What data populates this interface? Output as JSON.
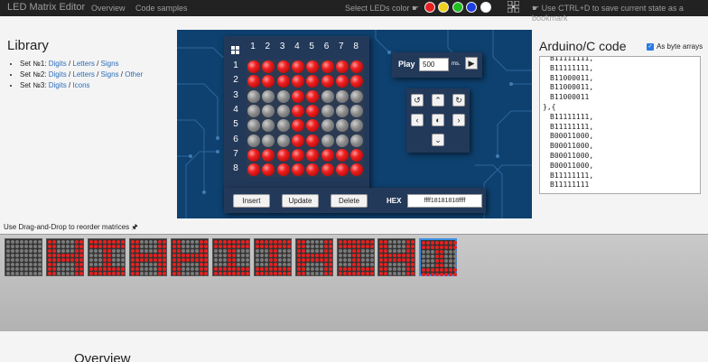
{
  "nav": {
    "brand": "LED Matrix Editor",
    "links": [
      "Overview",
      "Code samples"
    ],
    "color_label": "Select LEDs color",
    "colors": [
      "#e62020",
      "#f2d21c",
      "#21c021",
      "#1e3fe0",
      "#ffffff"
    ],
    "bookmark_text": "Use CTRL+D to save current state as a bookmark"
  },
  "library": {
    "title": "Library",
    "sets": [
      {
        "label": "Set №1:",
        "links": [
          "Digits",
          "Letters",
          "Signs"
        ]
      },
      {
        "label": "Set №2:",
        "links": [
          "Digits",
          "Letters",
          "Signs",
          "Other"
        ]
      },
      {
        "label": "Set №3:",
        "links": [
          "Digits",
          "Icons"
        ]
      }
    ]
  },
  "matrix": {
    "col_labels": [
      "1",
      "2",
      "3",
      "4",
      "5",
      "6",
      "7",
      "8"
    ],
    "row_labels": [
      "1",
      "2",
      "3",
      "4",
      "5",
      "6",
      "7",
      "8"
    ],
    "rows": [
      [
        1,
        1,
        1,
        1,
        1,
        1,
        1,
        1
      ],
      [
        1,
        1,
        1,
        1,
        1,
        1,
        1,
        1
      ],
      [
        0,
        0,
        0,
        1,
        1,
        0,
        0,
        0
      ],
      [
        0,
        0,
        0,
        1,
        1,
        0,
        0,
        0
      ],
      [
        0,
        0,
        0,
        1,
        1,
        0,
        0,
        0
      ],
      [
        0,
        0,
        0,
        1,
        1,
        0,
        0,
        0
      ],
      [
        1,
        1,
        1,
        1,
        1,
        1,
        1,
        1
      ],
      [
        1,
        1,
        1,
        1,
        1,
        1,
        1,
        1
      ]
    ],
    "led_on_color": "#e62020",
    "led_off_color": "#8a8a8a"
  },
  "play": {
    "label": "Play",
    "value": "500",
    "unit": "ms."
  },
  "actions": {
    "insert": "Insert",
    "update": "Update",
    "delete": "Delete",
    "hex_label": "HEX",
    "hex_value": "ffff18181818ffff"
  },
  "code": {
    "title": "Arduino/C code",
    "byte_arrays_label": "As byte arrays",
    "byte_arrays_checked": true,
    "lines": [
      "B11111111,",
      "B11111111,",
      "B11000011,",
      "B11000011,",
      "B11000011",
      "},{",
      "B11111111,",
      "B11111111,",
      "B00011000,",
      "B00011000,",
      "B00011000,",
      "B00011000,",
      "B11111111,",
      "B11111111"
    ]
  },
  "drag_hint": "Use Drag-and-Drop to reorder matrices",
  "thumbnails": [
    [
      0,
      0,
      0,
      0,
      0,
      0,
      0,
      0
    ],
    [
      "c3",
      "c3",
      "c3",
      "ff",
      "ff",
      "c3",
      "c3",
      "c3"
    ],
    [
      "ff",
      "ff",
      "18",
      "18",
      "18",
      "18",
      "ff",
      "ff"
    ],
    [
      "c3",
      "c3",
      "c3",
      "ff",
      "ff",
      "c3",
      "c3",
      "c3"
    ],
    [
      "c3",
      "c3",
      "c3",
      "ff",
      "ff",
      "c3",
      "c3",
      "c3"
    ],
    [
      "ff",
      "ff",
      "18",
      "18",
      "18",
      "18",
      "ff",
      "ff"
    ],
    [
      "ff",
      "ff",
      "18",
      "18",
      "18",
      "18",
      "ff",
      "ff"
    ],
    [
      "c3",
      "c3",
      "c3",
      "ff",
      "ff",
      "c3",
      "c3",
      "c3"
    ],
    [
      "ff",
      "ff",
      "18",
      "18",
      "18",
      "18",
      "ff",
      "ff"
    ],
    [
      "c3",
      "c3",
      "c3",
      "ff",
      "ff",
      "c3",
      "c3",
      "c3"
    ],
    [
      "ff",
      "ff",
      "18",
      "18",
      "18",
      "18",
      "ff",
      "ff"
    ]
  ],
  "overview_title": "Overview"
}
